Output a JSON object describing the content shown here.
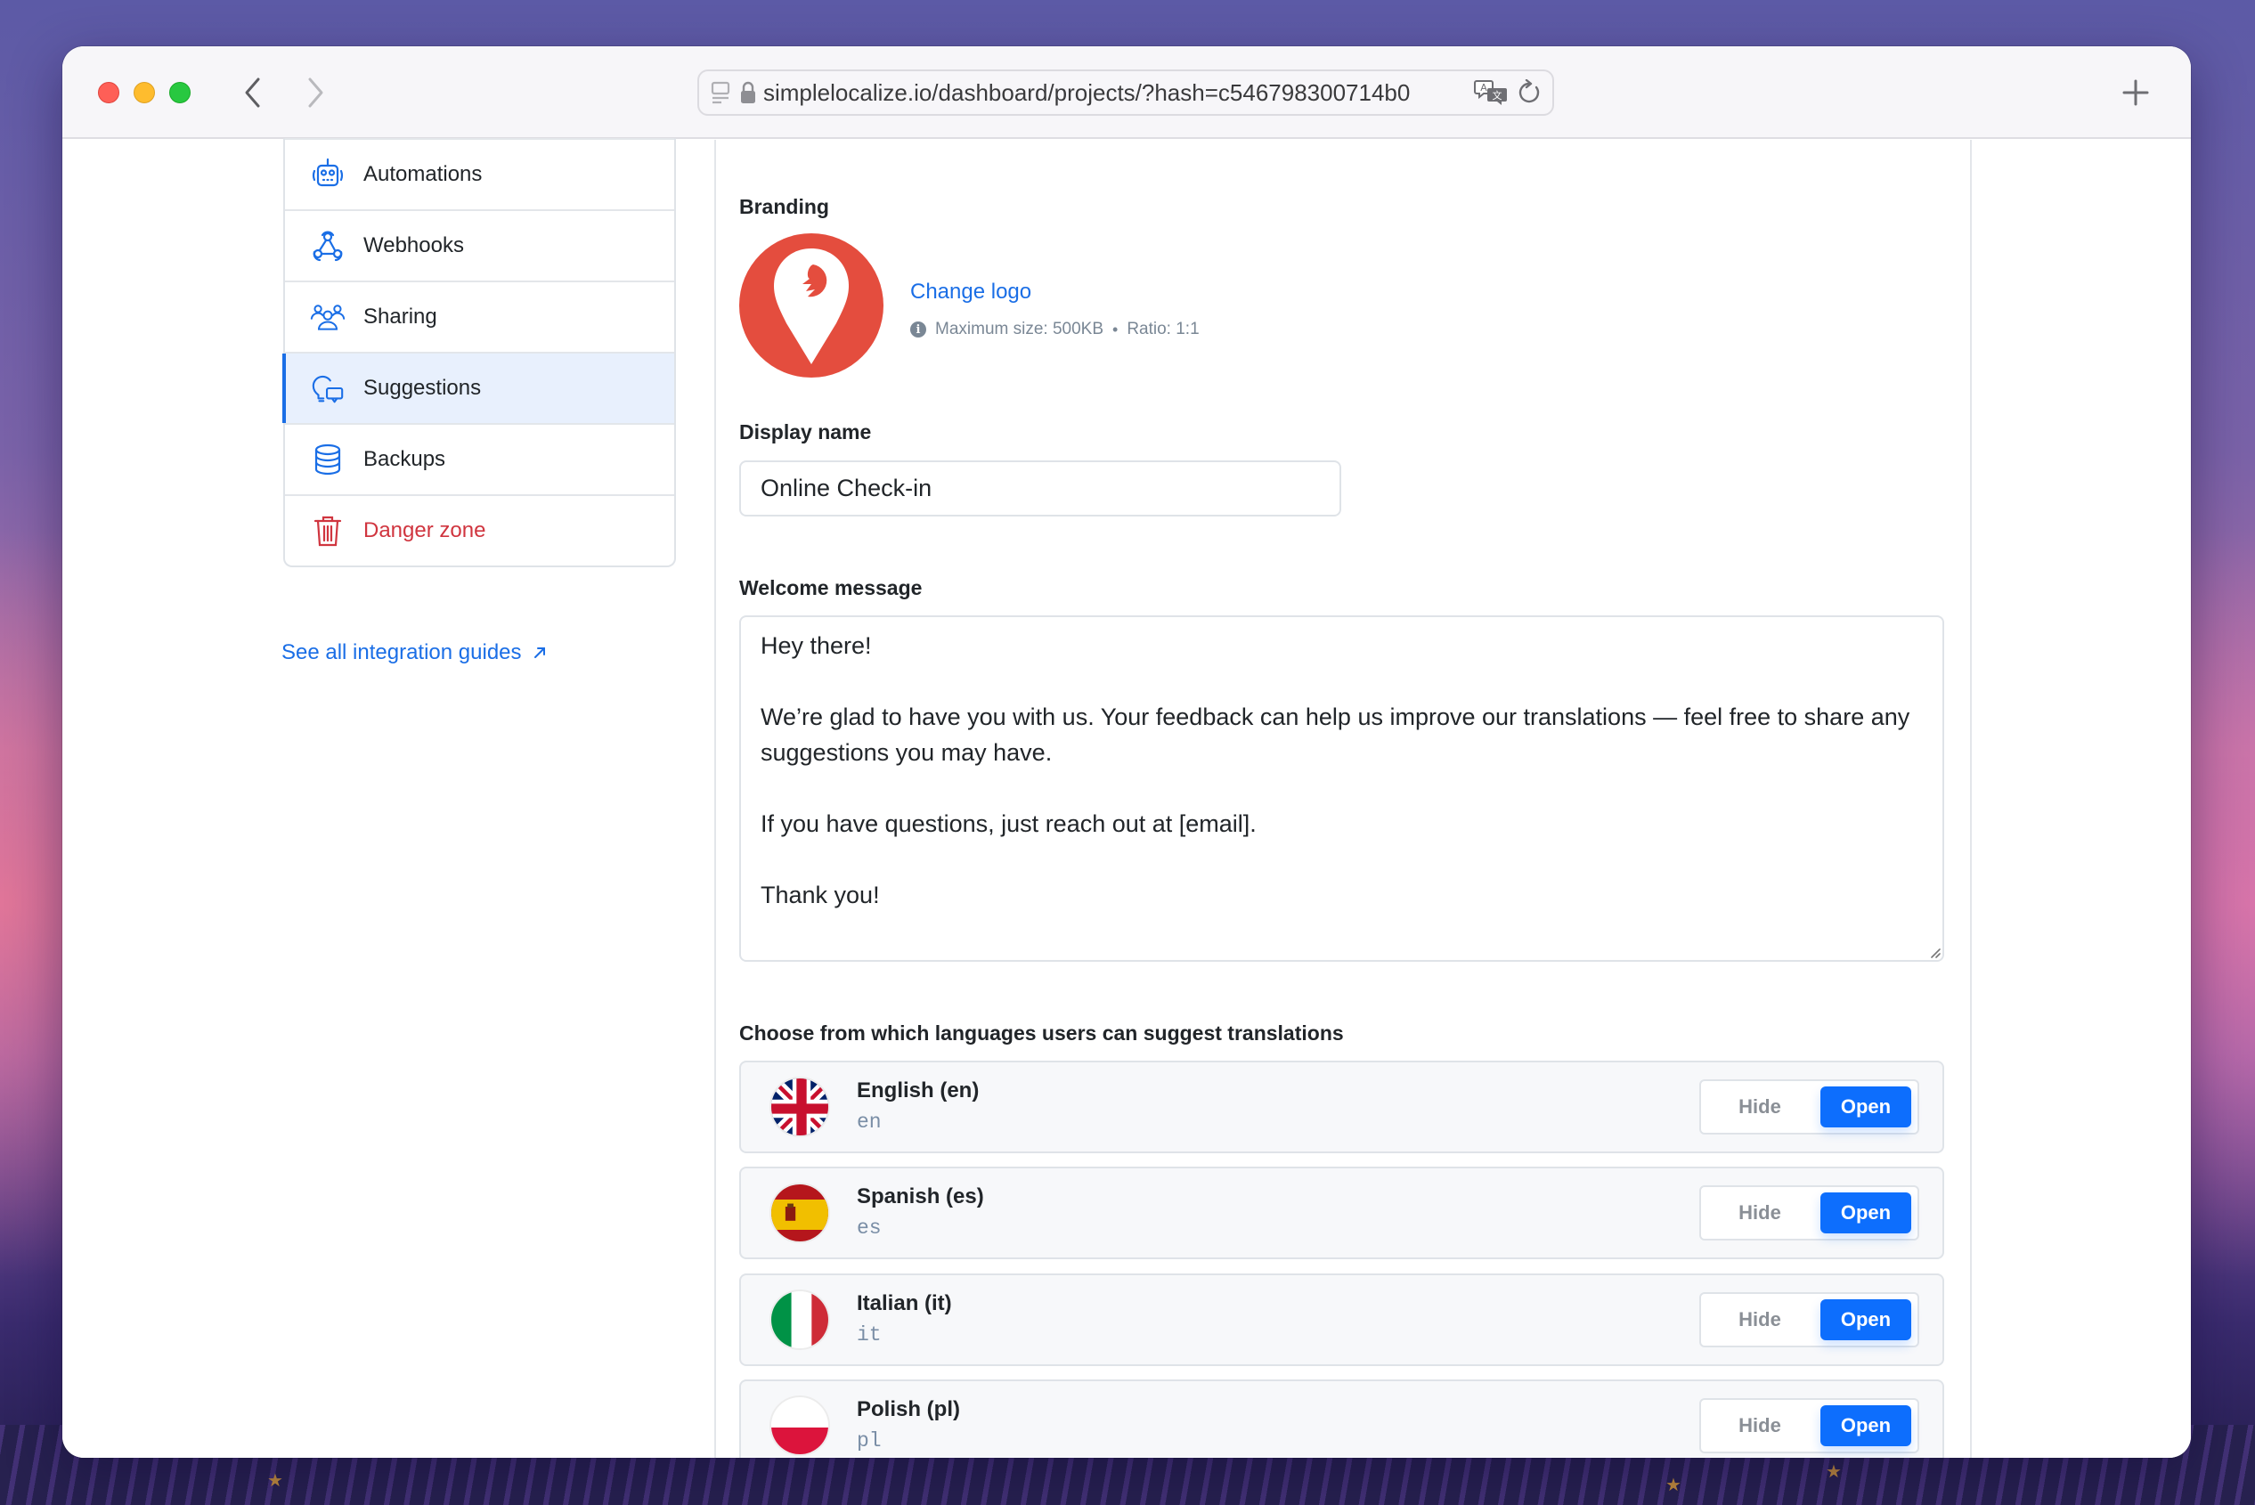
{
  "browser": {
    "url": "simplelocalize.io/dashboard/projects/?hash=c546798300714b0",
    "icons": {
      "sidebar": "sidebar-icon",
      "lock": "lock-icon",
      "translate": "translate-icon",
      "reload": "reload-icon",
      "back": "chevron-left-icon",
      "forward": "chevron-right-icon",
      "new_tab": "plus-icon"
    }
  },
  "sidebar": {
    "items": [
      {
        "label": "Automations",
        "icon": "robot-icon",
        "active": false
      },
      {
        "label": "Webhooks",
        "icon": "webhook-icon",
        "active": false
      },
      {
        "label": "Sharing",
        "icon": "users-icon",
        "active": false
      },
      {
        "label": "Suggestions",
        "icon": "suggestions-icon",
        "active": true
      },
      {
        "label": "Backups",
        "icon": "database-icon",
        "active": false
      },
      {
        "label": "Danger zone",
        "icon": "trash-icon",
        "active": false
      }
    ],
    "guides_link": "See all integration guides",
    "guides_icon": "external-arrow-icon"
  },
  "main": {
    "branding": {
      "label": "Branding",
      "change_logo": "Change logo",
      "max_size": "Maximum size: 500KB",
      "separator": "•",
      "ratio": "Ratio: 1:1"
    },
    "display_name": {
      "label": "Display name",
      "value": "Online Check-in"
    },
    "welcome_message": {
      "label": "Welcome message",
      "value": "Hey there!\n\nWe’re glad to have you with us. Your feedback can help us improve our translations — feel free to share any suggestions you may have.\n\nIf you have questions, just reach out at [email].\n\nThank you!"
    },
    "languages": {
      "label": "Choose from which languages users can suggest translations",
      "hide_label": "Hide",
      "open_label": "Open",
      "items": [
        {
          "name": "English (en)",
          "code": "en",
          "flag": "uk-flag-icon",
          "state": "Open"
        },
        {
          "name": "Spanish (es)",
          "code": "es",
          "flag": "spain-flag-icon",
          "state": "Open"
        },
        {
          "name": "Italian (it)",
          "code": "it",
          "flag": "italy-flag-icon",
          "state": "Open"
        },
        {
          "name": "Polish (pl)",
          "code": "pl",
          "flag": "poland-flag-icon",
          "state": "Open"
        }
      ]
    }
  },
  "colors": {
    "accent": "#0d6efd",
    "link": "#1a6ee6",
    "danger": "#d0353f",
    "logo": "#e44d3e",
    "active_bg": "#e8f0fd"
  }
}
